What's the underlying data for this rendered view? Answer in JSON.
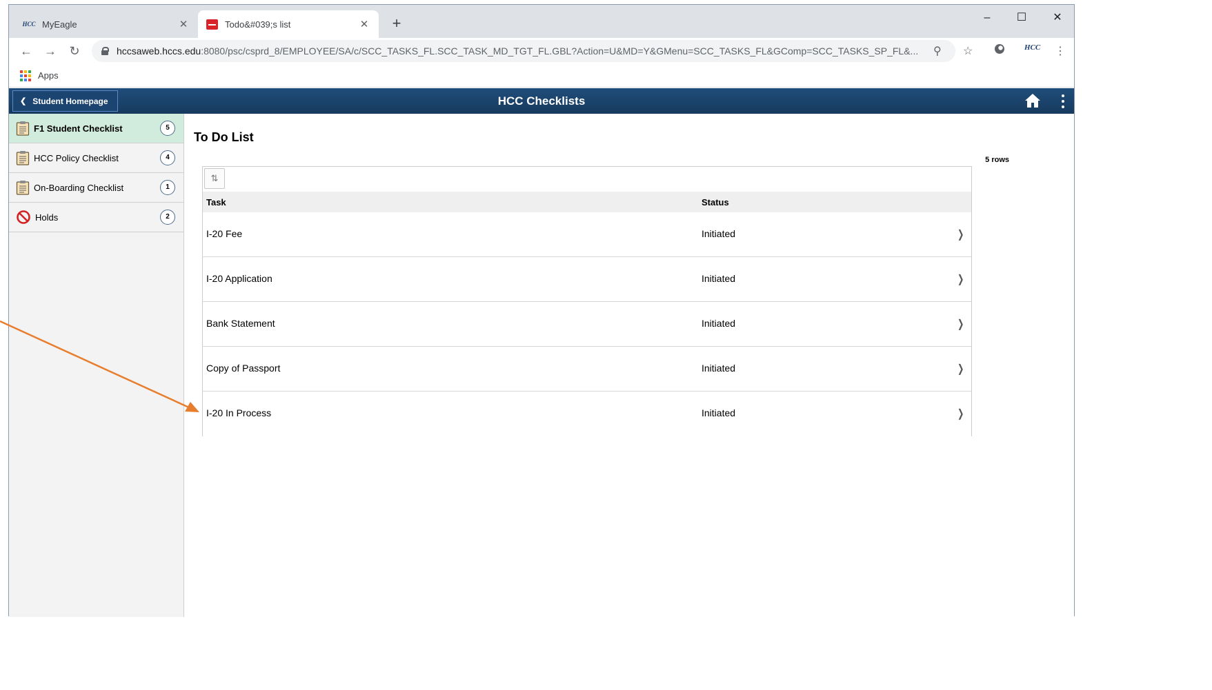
{
  "browser": {
    "tabs": [
      {
        "title": "MyEagle",
        "favicon": "hcc-logo-icon",
        "active": false
      },
      {
        "title": "Todo&#039;s list",
        "favicon": "peoplesoft-red-icon",
        "active": true
      }
    ],
    "address": {
      "host": "hccsaweb.hccs.edu",
      "rest": ":8080/psc/csprd_8/EMPLOYEE/SA/c/SCC_TASKS_FL.SCC_TASK_MD_TGT_FL.GBL?Action=U&MD=Y&GMenu=SCC_TASKS_FL&GComp=SCC_TASKS_SP_FL&..."
    },
    "bookmarks": {
      "apps_label": "Apps"
    }
  },
  "banner": {
    "back_label": "Student Homepage",
    "title": "HCC Checklists"
  },
  "sidebar": {
    "items": [
      {
        "label": "F1 Student Checklist",
        "count": "5",
        "icon": "clipboard-icon",
        "selected": true
      },
      {
        "label": "HCC Policy Checklist",
        "count": "4",
        "icon": "clipboard-icon",
        "selected": false
      },
      {
        "label": "On-Boarding Checklist",
        "count": "1",
        "icon": "clipboard-icon",
        "selected": false
      },
      {
        "label": "Holds",
        "count": "2",
        "icon": "no-entry-icon",
        "selected": false
      }
    ]
  },
  "main": {
    "title": "To Do List",
    "row_count": "5 rows",
    "columns": {
      "task": "Task",
      "status": "Status"
    },
    "rows": [
      {
        "task": "I-20 Fee",
        "status": "Initiated"
      },
      {
        "task": "I-20 Application",
        "status": "Initiated"
      },
      {
        "task": "Bank Statement",
        "status": "Initiated"
      },
      {
        "task": "Copy of Passport",
        "status": "Initiated"
      },
      {
        "task": "I-20 In Process",
        "status": "Initiated"
      }
    ]
  },
  "colors": {
    "banner": "#1f4d7a",
    "selected_nav": "#d1ebdc",
    "annotation_arrow": "#e87d2e"
  }
}
